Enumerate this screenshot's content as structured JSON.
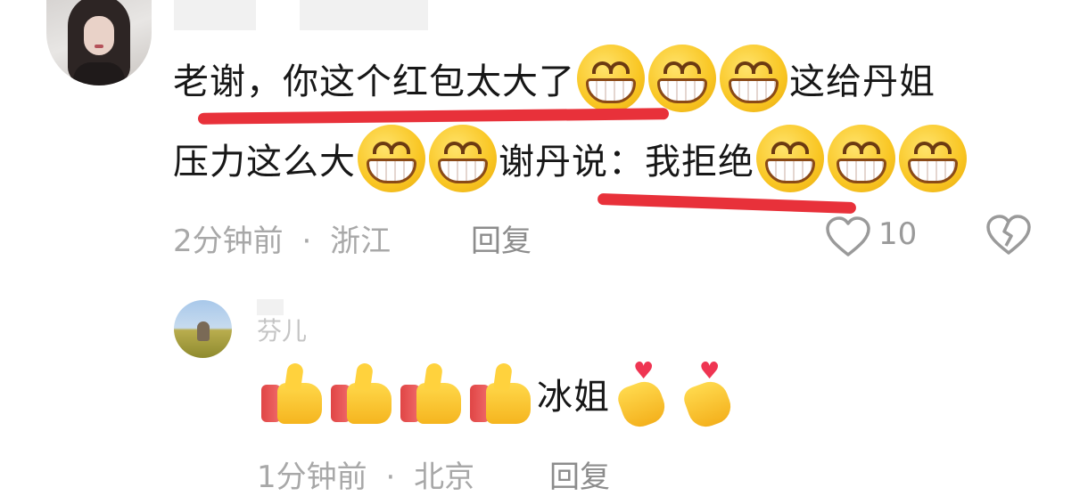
{
  "comment": {
    "line1_pre": "老谢，你这个红包太大了",
    "line1_post": "这给丹姐",
    "line2_pre": "压力这么大",
    "line2_mid": "谢丹说：我拒绝",
    "time": "2分钟前",
    "dot": "·",
    "location": "浙江",
    "reply_label": "回复",
    "like_count": "10",
    "emoji_grin": "grin-emoji",
    "underline_color": "#e8313a"
  },
  "reply": {
    "username": "芬儿",
    "text": "冰姐",
    "time": "1分钟前",
    "dot": "·",
    "location": "北京",
    "reply_label": "回复",
    "emoji_thumb": "thumbs-up-emoji",
    "emoji_finger_heart": "finger-heart-emoji"
  }
}
